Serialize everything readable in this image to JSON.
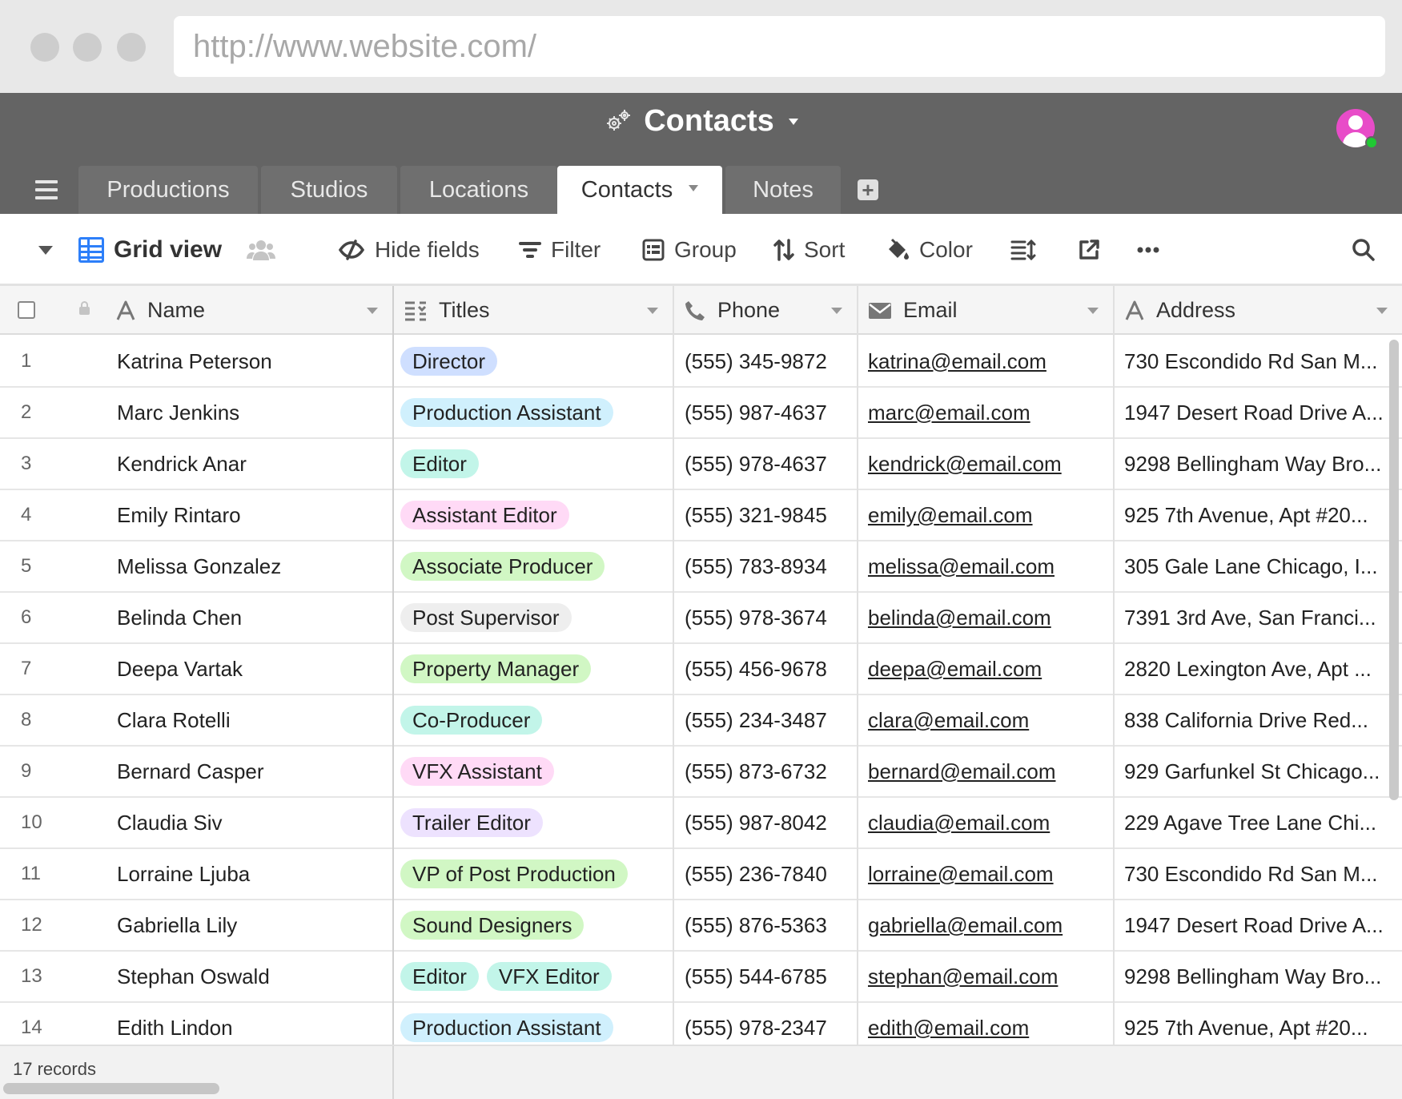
{
  "browser": {
    "url": "http://www.website.com/"
  },
  "base": {
    "title": "Contacts"
  },
  "tabs": [
    {
      "label": "Productions"
    },
    {
      "label": "Studios"
    },
    {
      "label": "Locations"
    },
    {
      "label": "Contacts",
      "active": true
    },
    {
      "label": "Notes"
    }
  ],
  "toolbar": {
    "view_name": "Grid view",
    "hide_fields": "Hide fields",
    "filter": "Filter",
    "group": "Group",
    "sort": "Sort",
    "color": "Color"
  },
  "columns": {
    "name": "Name",
    "titles": "Titles",
    "phone": "Phone",
    "email": "Email",
    "address": "Address"
  },
  "title_colors": {
    "Director": "#cfdfff",
    "Production Assistant": "#d0f0fd",
    "Editor": "#c2f5e9",
    "Assistant Editor": "#ffdaf6",
    "Associate Producer": "#d1f7c4",
    "Post Supervisor": "#eeeeee",
    "Property Manager": "#d1f7c4",
    "Co-Producer": "#c2f5e9",
    "VFX Assistant": "#ffdaf6",
    "Trailer Editor": "#ede2fe",
    "VP of Post Production": "#d1f7c4",
    "Sound Designers": "#d1f7c4",
    "VFX Editor": "#c2f5e9"
  },
  "rows": [
    {
      "n": "1",
      "name": "Katrina Peterson",
      "titles": [
        "Director"
      ],
      "phone": "(555) 345-9872",
      "email": "katrina@email.com",
      "address": "730 Escondido Rd San M..."
    },
    {
      "n": "2",
      "name": "Marc Jenkins",
      "titles": [
        "Production Assistant"
      ],
      "phone": "(555) 987-4637",
      "email": "marc@email.com",
      "address": "1947 Desert Road Drive A..."
    },
    {
      "n": "3",
      "name": "Kendrick Anar",
      "titles": [
        "Editor"
      ],
      "phone": "(555) 978-4637",
      "email": "kendrick@email.com",
      "address": "9298 Bellingham Way Bro..."
    },
    {
      "n": "4",
      "name": "Emily Rintaro",
      "titles": [
        "Assistant Editor"
      ],
      "phone": "(555) 321-9845",
      "email": "emily@email.com",
      "address": "925 7th Avenue, Apt #20..."
    },
    {
      "n": "5",
      "name": "Melissa Gonzalez",
      "titles": [
        "Associate Producer"
      ],
      "phone": "(555) 783-8934",
      "email": "melissa@email.com",
      "address": "305 Gale Lane Chicago, I..."
    },
    {
      "n": "6",
      "name": "Belinda Chen",
      "titles": [
        "Post Supervisor"
      ],
      "phone": "(555) 978-3674",
      "email": "belinda@email.com",
      "address": "7391 3rd Ave, San Franci..."
    },
    {
      "n": "7",
      "name": "Deepa Vartak",
      "titles": [
        "Property Manager"
      ],
      "phone": "(555) 456-9678",
      "email": "deepa@email.com",
      "address": "2820 Lexington Ave, Apt ..."
    },
    {
      "n": "8",
      "name": "Clara Rotelli",
      "titles": [
        "Co-Producer"
      ],
      "phone": "(555) 234-3487",
      "email": "clara@email.com",
      "address": "838 California Drive Red..."
    },
    {
      "n": "9",
      "name": "Bernard Casper",
      "titles": [
        "VFX Assistant"
      ],
      "phone": "(555) 873-6732",
      "email": "bernard@email.com",
      "address": "929 Garfunkel St Chicago..."
    },
    {
      "n": "10",
      "name": "Claudia Siv",
      "titles": [
        "Trailer Editor"
      ],
      "phone": "(555) 987-8042",
      "email": "claudia@email.com",
      "address": "229 Agave Tree Lane Chi..."
    },
    {
      "n": "11",
      "name": "Lorraine Ljuba",
      "titles": [
        "VP of Post Production"
      ],
      "phone": "(555) 236-7840",
      "email": "lorraine@email.com",
      "address": "730 Escondido Rd San M..."
    },
    {
      "n": "12",
      "name": "Gabriella Lily",
      "titles": [
        "Sound Designers"
      ],
      "phone": "(555) 876-5363",
      "email": "gabriella@email.com",
      "address": "1947 Desert Road Drive A..."
    },
    {
      "n": "13",
      "name": "Stephan Oswald",
      "titles": [
        "Editor",
        "VFX Editor"
      ],
      "phone": "(555) 544-6785",
      "email": "stephan@email.com",
      "address": "9298 Bellingham Way Bro..."
    },
    {
      "n": "14",
      "name": "Edith Lindon",
      "titles": [
        "Production Assistant"
      ],
      "phone": "(555) 978-2347",
      "email": "edith@email.com",
      "address": "925 7th Avenue, Apt #20..."
    }
  ],
  "footer": {
    "record_count": "17 records"
  }
}
